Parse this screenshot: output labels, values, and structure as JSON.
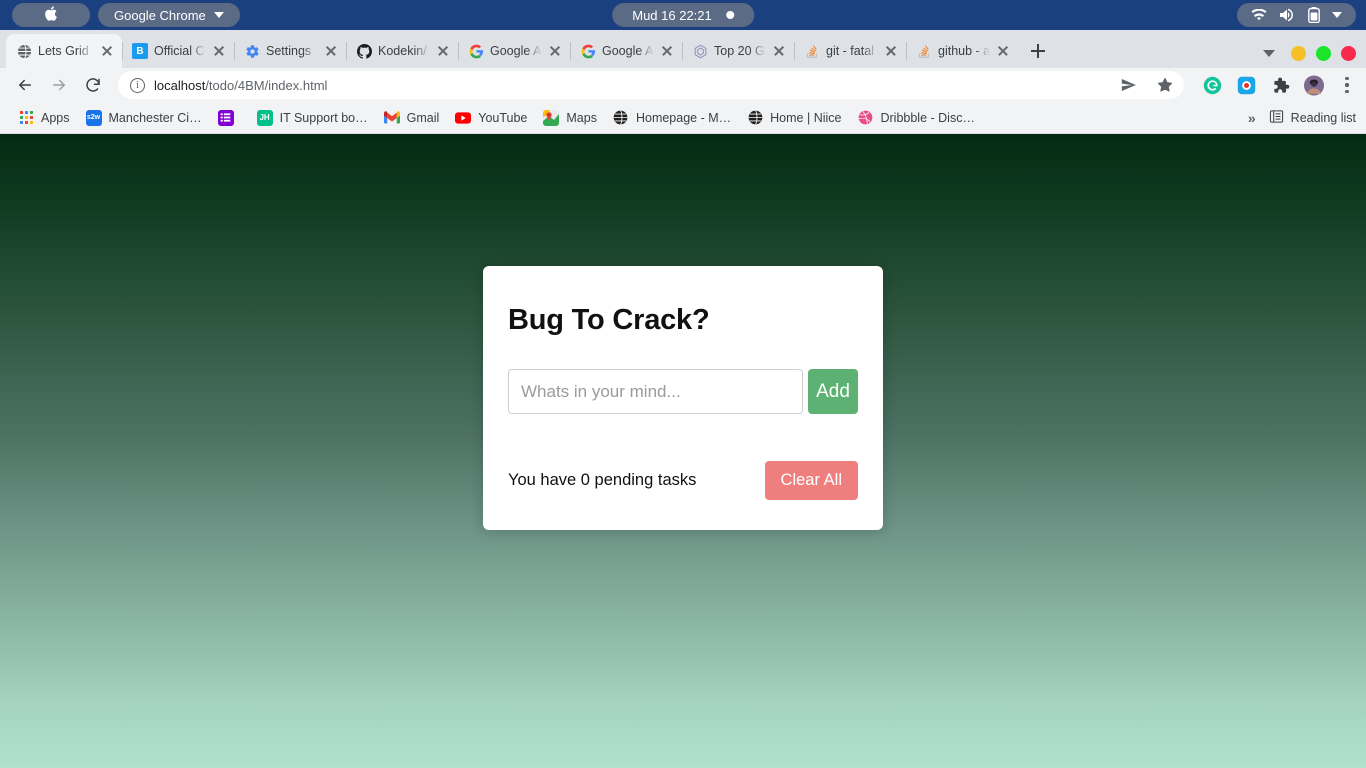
{
  "os_menubar": {
    "apple_icon": "apple-logo-icon",
    "app_name": "Google Chrome",
    "clock": "Mud 16  22:21",
    "status_icons": [
      "wifi-icon",
      "volume-icon",
      "battery-icon",
      "chevron-down-icon"
    ]
  },
  "browser": {
    "tabs": [
      {
        "title": "Lets Grid",
        "favicon": "globe-icon",
        "active": true
      },
      {
        "title": "Official C",
        "favicon": "blue-b-icon",
        "active": false
      },
      {
        "title": "Settings",
        "favicon": "gear-icon",
        "active": false
      },
      {
        "title": "Kodekin/",
        "favicon": "github-icon",
        "active": false
      },
      {
        "title": "Google A",
        "favicon": "google-g-icon",
        "active": false
      },
      {
        "title": "Google A",
        "favicon": "google-g-icon",
        "active": false
      },
      {
        "title": "Top 20 Gi",
        "favicon": "hexagon-icon",
        "active": false
      },
      {
        "title": "git - fatal",
        "favicon": "stack-overflow-icon",
        "active": false
      },
      {
        "title": "github - a",
        "favicon": "stack-overflow-icon",
        "active": false
      }
    ],
    "new_tab_label": "+",
    "window_buttons": [
      "minimize-yellow",
      "maximize-green",
      "close-red"
    ],
    "toolbar": {
      "back_label": "Back",
      "forward_label": "Forward",
      "reload_label": "Reload",
      "url_host": "localhost",
      "url_path": "/todo/4BM/index.html",
      "site_info_icon": "info-circle-icon",
      "share_icon": "send-icon",
      "bookmark_icon": "star-icon",
      "extensions": [
        "grammarly-icon",
        "screen-recorder-icon",
        "puzzle-icon",
        "profile-avatar"
      ],
      "menu_icon": "kebab-menu-icon"
    },
    "bookmarks": [
      {
        "label": "Apps",
        "icon": "apps-grid-icon"
      },
      {
        "label": "Manchester Ci…",
        "icon": "s2w-icon"
      },
      {
        "label": "",
        "icon": "purple-list-icon"
      },
      {
        "label": "IT Support bo…",
        "icon": "jh-icon"
      },
      {
        "label": "Gmail",
        "icon": "gmail-icon"
      },
      {
        "label": "YouTube",
        "icon": "youtube-icon"
      },
      {
        "label": "Maps",
        "icon": "maps-icon"
      },
      {
        "label": "Homepage - M…",
        "icon": "dark-globe-icon"
      },
      {
        "label": "Home | Niice",
        "icon": "dark-globe-icon"
      },
      {
        "label": "Dribbble - Disc…",
        "icon": "dribbble-icon"
      }
    ],
    "bookmarks_overflow": "»",
    "reading_list": {
      "label": "Reading list",
      "icon": "reading-list-icon"
    }
  },
  "page": {
    "card": {
      "title": "Bug To Crack?",
      "input_value": "",
      "input_placeholder": "Whats in your mind...",
      "add_label": "Add",
      "pending_text": "You have 0 pending tasks",
      "clear_label": "Clear All"
    },
    "colors": {
      "add_button": "#5cb173",
      "clear_button": "#ef7f7f",
      "bg_top": "#042a12",
      "bg_bottom": "#b2e2cd",
      "card": "#ffffff"
    }
  }
}
